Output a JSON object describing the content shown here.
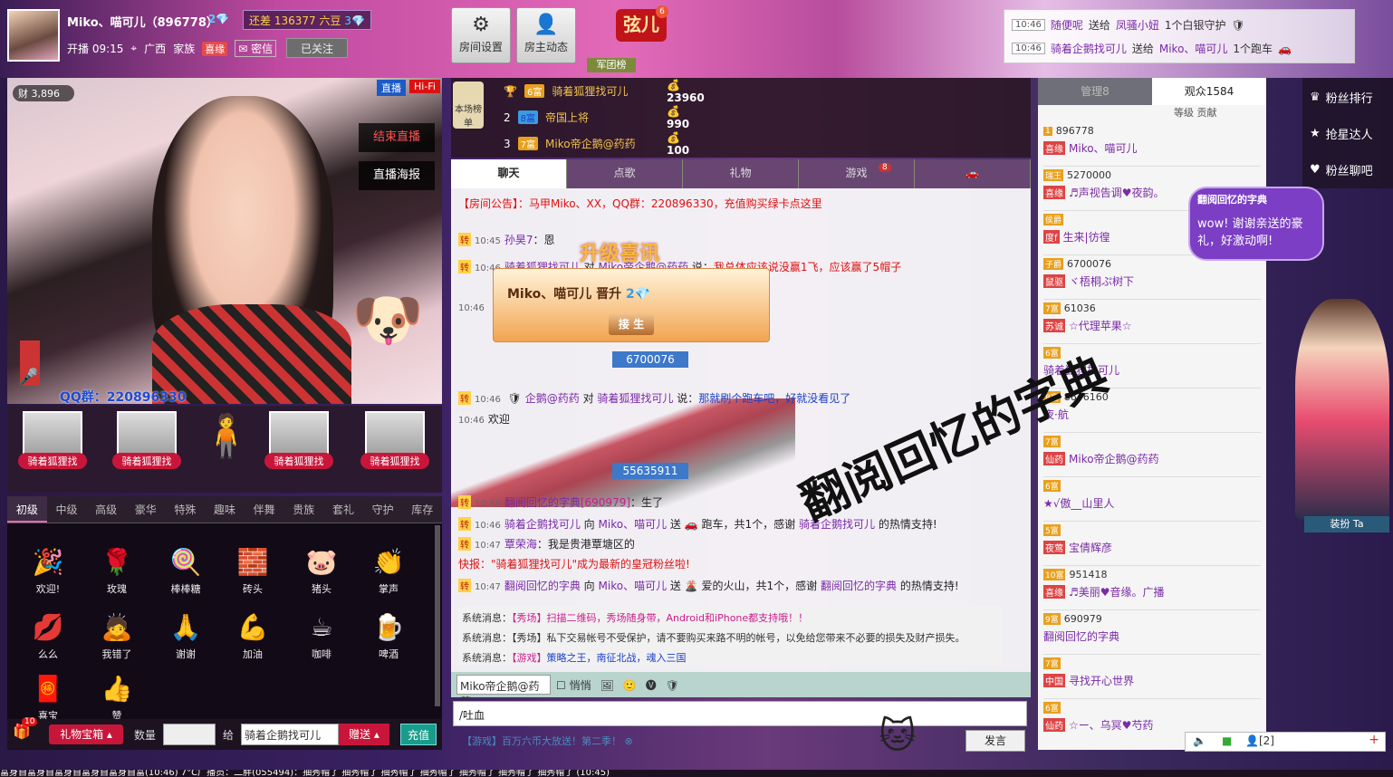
{
  "header": {
    "host_name": "Miko、喵可儿（896778）",
    "host_level": "2",
    "gap_label": "还差",
    "gap_value": "136377 六豆",
    "gap_level": "3",
    "live_time": "开播 09:15",
    "location": "广西",
    "family_label": "家族",
    "family_badge": "喜缘",
    "msg_label": "密信",
    "follow_label": "已关注",
    "room_settings": "房间设置",
    "host_activity": "房主动态",
    "xian": "弦儿",
    "xian_badge": "6",
    "legion": "军团榜"
  },
  "notifications": [
    {
      "time": "10:46",
      "user": "随便呢",
      "action": "送给",
      "target": "凤骚小妞",
      "gift": "1个白银守护"
    },
    {
      "time": "10:46",
      "user": "骑着企鹅找可儿",
      "action": "送给",
      "target": "Miko、喵可儿",
      "gift": "1个跑车"
    }
  ],
  "video": {
    "wealth": "3,896",
    "live_tag": "直播",
    "hifi": "Hi-Fi",
    "end_live": "结束直播",
    "poster": "直播海报",
    "qq": "QQ群：220896330"
  },
  "seats": [
    {
      "name": "骑着狐狸找"
    },
    {
      "name": "骑着狐狸找"
    },
    {
      "name": ""
    },
    {
      "name": "骑着狐狸找"
    },
    {
      "name": "骑着狐狸找"
    }
  ],
  "gift_tabs": [
    "初级",
    "中级",
    "高级",
    "豪华",
    "特殊",
    "趣味",
    "伴舞",
    "贵族",
    "套礼",
    "守护",
    "库存"
  ],
  "gifts": [
    {
      "name": "欢迎!",
      "icon": "🎉"
    },
    {
      "name": "玫瑰",
      "icon": "🌹"
    },
    {
      "name": "棒棒糖",
      "icon": "🍭"
    },
    {
      "name": "砖头",
      "icon": "🧱"
    },
    {
      "name": "猪头",
      "icon": "🐷"
    },
    {
      "name": "掌声",
      "icon": "👏"
    },
    {
      "name": "么么",
      "icon": "💋"
    },
    {
      "name": "我错了",
      "icon": "🙇"
    },
    {
      "name": "谢谢",
      "icon": "🙏"
    },
    {
      "name": "加油",
      "icon": "💪"
    },
    {
      "name": "咖啡",
      "icon": "☕"
    },
    {
      "name": "啤酒",
      "icon": "🍺"
    },
    {
      "name": "喜宝",
      "icon": "🧧"
    },
    {
      "name": "赞",
      "icon": "👍"
    }
  ],
  "gift_bar": {
    "box": "礼物宝箱",
    "box_badge": "10",
    "qty_label": "数量",
    "to_label": "给",
    "to_value": "骑着企鹅找可儿",
    "send": "赠送",
    "recharge": "充值"
  },
  "rank": {
    "head": "本场榜单",
    "rows": [
      {
        "pos": "1",
        "lv": "6富",
        "name": "骑着狐狸找可儿",
        "val": "23960"
      },
      {
        "pos": "2",
        "lv": "8富",
        "name": "帝国上将",
        "val": "990"
      },
      {
        "pos": "3",
        "lv": "7富",
        "name": "Miko帝企鹅@药药",
        "val": "100"
      }
    ]
  },
  "chat_tabs": [
    "聊天",
    "点歌",
    "礼物",
    "游戏",
    "🚗"
  ],
  "chat_tab_badge": "8",
  "chat": {
    "announce": "【房间公告】：马甲Miko、XX，QQ群：220896330，充值购买绿卡点这里",
    "l1_time": "10:45",
    "l1_user": "孙昊7",
    "l1_text": "：恩",
    "l2_time": "10:46",
    "l2_user": "骑着狐狸找可儿",
    "l2_mid": "对",
    "l2_target": "Miko帝企鹅@药药",
    "l2_say": "说：",
    "l2_text": "我总体应该说没赢1飞，应该赢了5帽子",
    "l3_time": "10:46",
    "l4_time": "10:46",
    "l4_user": "企鹅@药药",
    "l4_mid": "对",
    "l4_target": "骑着狐狸找可儿",
    "l4_say": "说：",
    "l4_text": "那就刷个跑车吧，好就没看见了",
    "l5_time": "10:46",
    "l5_text": "欢迎",
    "l6_time": "10:46",
    "l6_user": "翻阅回忆的字典",
    "l6_id": "[690979]",
    "l6_text": "：生了",
    "l7_time": "10:46",
    "l7_user": "骑着企鹅找可儿",
    "l7_mid": "向",
    "l7_target": "Miko、喵可儿",
    "l7_send": "送",
    "l7_text": "跑车，共1个，感谢",
    "l7_user2": "骑着企鹅找可儿",
    "l7_tail": "的热情支持!",
    "l8_time": "10:47",
    "l8_user": "覃荣海",
    "l8_text": "：我是贵港覃塘区的",
    "l9_text": "快报：\"骑着狐狸找可儿\"成为最新的皇冠粉丝啦!",
    "l10_time": "10:47",
    "l10_user": "翻阅回忆的字典",
    "l10_mid": "向",
    "l10_target": "Miko、喵可儿",
    "l10_send": "送",
    "l10_text": "爱的火山，共1个，感谢",
    "l10_user2": "翻阅回忆的字典",
    "l10_tail": "的热情支持!",
    "num1": "6700076",
    "num2": "55635911"
  },
  "popup": {
    "upgrade": "升级喜讯",
    "title": "Miko、喵可儿 晋升",
    "level": "2",
    "btn": "接 生"
  },
  "system": [
    {
      "label": "系统消息：",
      "tag": "【秀场】",
      "text": "扫描二维码，秀场随身带，Android和iPhone都支持哦！！"
    },
    {
      "label": "系统消息：",
      "tag": "【秀场】",
      "text": "私下交易帐号不受保护，请不要购买来路不明的帐号，以免给您带来不必要的损失及财产损失。"
    },
    {
      "label": "系统消息：",
      "tag": "【游戏】",
      "text": "策略之王，南征北战，魂入三国"
    }
  ],
  "chat_input": {
    "user": "Miko帝企鹅@药药",
    "whisper": "悄悄",
    "value": "/吐血",
    "promo": "【游戏】百万六币大放送！第二季！",
    "speak": "发言"
  },
  "right": {
    "tab_admin": "管理8",
    "tab_audience": "观众1584",
    "sub": "等级 贡献",
    "users": [
      {
        "lv": "1",
        "id": "896778",
        "cls": "喜缘",
        "name": "Miko、喵可儿"
      },
      {
        "lv": "瑞王",
        "id": "5270000",
        "cls": "喜缘",
        "name": "♬声视告调♥夜韵。"
      },
      {
        "lv": "侯爵",
        "id": "",
        "cls": "度f",
        "name": "生来|彷徨"
      },
      {
        "lv": "子爵",
        "id": "6700076",
        "cls": "鼠驱",
        "name": "ヾ梧桐ぷ树下"
      },
      {
        "lv": "7富",
        "id": "61036",
        "cls": "苏诚",
        "name": "☆代理苹果☆"
      },
      {
        "lv": "6富",
        "id": "",
        "cls": "",
        "name": "骑着狐狸找可儿"
      },
      {
        "lv": "8富",
        "id": "8676160",
        "cls": "",
        "name": "夜·航"
      },
      {
        "lv": "7富",
        "id": "",
        "cls": "仙药",
        "name": "Miko帝企鹅@药药"
      },
      {
        "lv": "6富",
        "id": "",
        "cls": "",
        "name": "★√傲__山里人"
      },
      {
        "lv": "5富",
        "id": "",
        "cls": "夜莺",
        "name": "宝倩辉彦"
      },
      {
        "lv": "10富",
        "id": "951418",
        "cls": "喜缘",
        "name": "♬美丽♥音缘。广播"
      },
      {
        "lv": "9富",
        "id": "690979",
        "cls": "",
        "name": "翻阅回忆的字典"
      },
      {
        "lv": "7富",
        "id": "",
        "cls": "中国",
        "name": "寻找开心世界"
      },
      {
        "lv": "6富",
        "id": "",
        "cls": "仙药",
        "name": "☆ー、乌冥♥芍药"
      }
    ],
    "bottom_count": "[2]"
  },
  "fans": [
    {
      "label": "粉丝排行",
      "icon": "crown-icon"
    },
    {
      "label": "抢星达人",
      "icon": "star-icon"
    },
    {
      "label": "粉丝聊吧",
      "icon": "heart-icon"
    }
  ],
  "bubble": {
    "title": "翻阅回忆的字典",
    "msg": "wow! 谢谢亲送的豪礼，好激动啊!"
  },
  "dress_btn": "装扮 Ta",
  "watermark": "翻阅回忆的字典",
  "statusbar": "富身自富身自富身自富身自富身自富(10:46)    7°C广播员：二胖(055494)：抽秀帽了 抽秀帽了 抽秀帽了 抽秀帽了 抽秀帽了 抽秀帽了 抽秀帽了 (10:45)"
}
